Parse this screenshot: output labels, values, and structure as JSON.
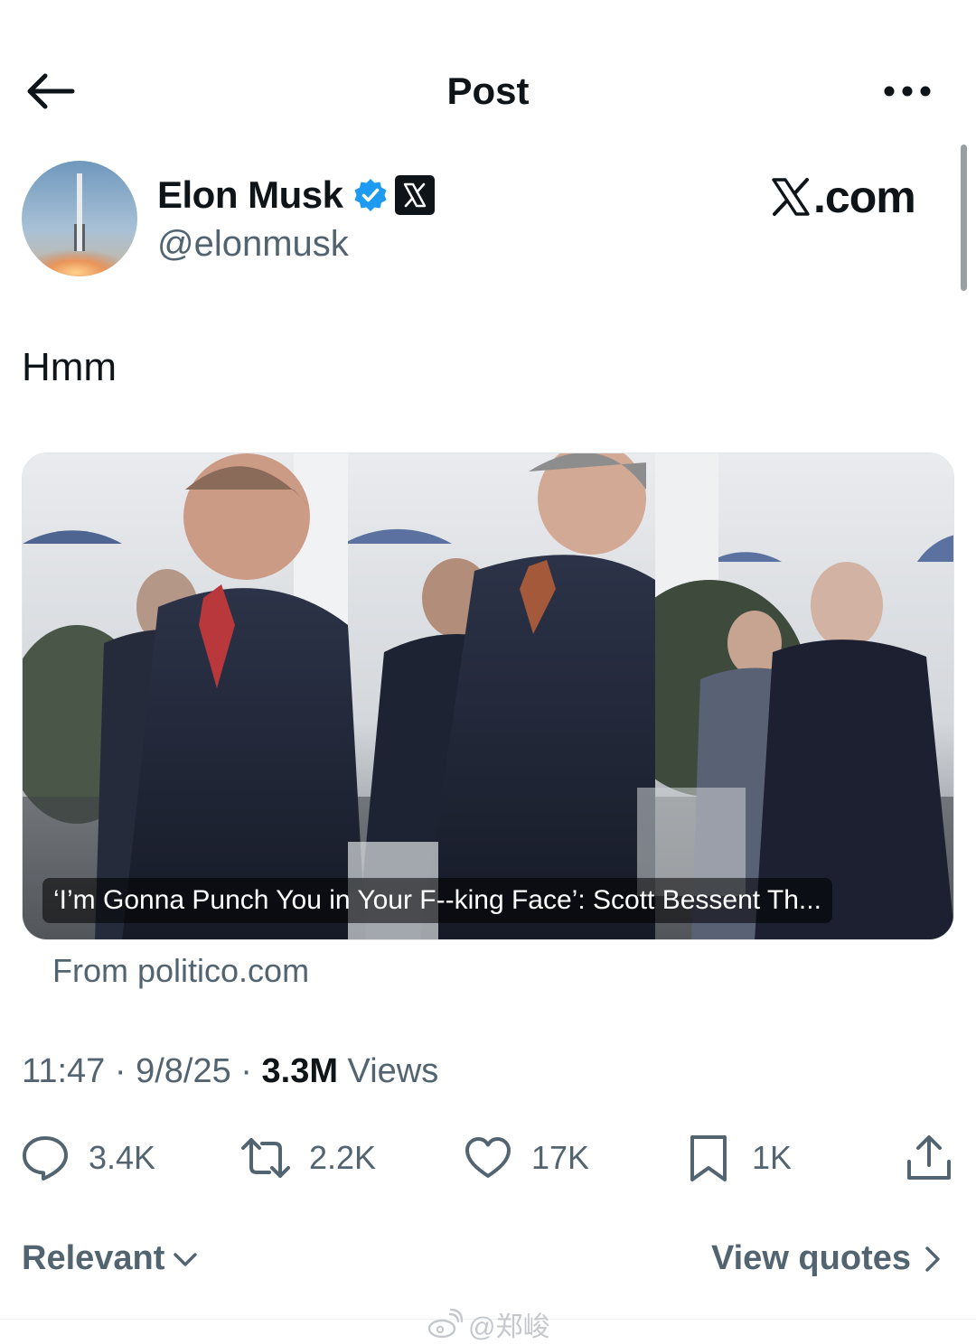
{
  "header": {
    "title": "Post"
  },
  "author": {
    "name": "Elon Musk",
    "handle": "@elonmusk",
    "verified": true
  },
  "brand": {
    "wordmark": ".com"
  },
  "post": {
    "text": "Hmm"
  },
  "link_card": {
    "caption": "‘I’m Gonna Punch You in Your F--king Face’: Scott Bessent Th...",
    "source": "From politico.com"
  },
  "meta": {
    "time": "11:47",
    "date": "9/8/25",
    "views_count": "3.3M",
    "views_label": "Views",
    "separator": "·"
  },
  "actions": {
    "replies": "3.4K",
    "reposts": "2.2K",
    "likes": "17K",
    "bookmarks": "1K"
  },
  "footer": {
    "sort_label": "Relevant",
    "view_quotes_label": "View quotes"
  },
  "watermark": {
    "text": "@郑峻"
  },
  "icons": {
    "back": "arrow-left-icon",
    "more": "more-horizontal-icon",
    "reply": "reply-bubble-icon",
    "repost": "repost-icon",
    "like": "heart-icon",
    "bookmark": "bookmark-icon",
    "share": "share-icon"
  },
  "colors": {
    "text": "#0f1419",
    "secondary": "#536471",
    "verified": "#1d9bf0"
  }
}
